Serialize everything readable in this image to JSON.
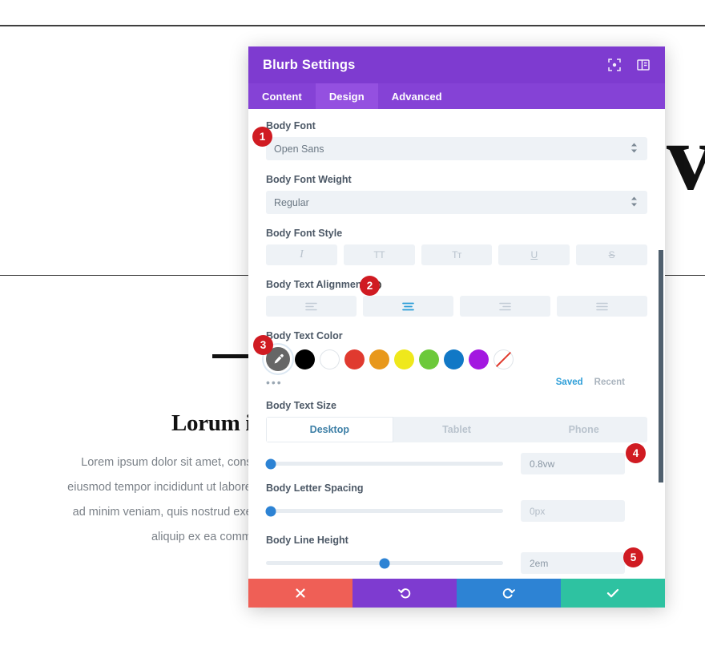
{
  "background": {
    "heading": "Lorum ip",
    "paragraph_lines": [
      "Lorem ipsum dolor sit amet, consec",
      "eiusmod tempor incididunt ut labore et",
      "ad minim veniam, quis nostrud exerci",
      "aliquip ex ea commod"
    ],
    "big_letters": "vi"
  },
  "modal": {
    "title": "Blurb Settings",
    "header_icons": [
      {
        "name": "focus-icon"
      },
      {
        "name": "layout-panel-icon"
      }
    ],
    "tabs": [
      {
        "label": "Content",
        "active": false
      },
      {
        "label": "Design",
        "active": true
      },
      {
        "label": "Advanced",
        "active": false
      }
    ],
    "fields": {
      "body_font": {
        "label": "Body Font",
        "value": "Open Sans"
      },
      "body_font_weight": {
        "label": "Body Font Weight",
        "value": "Regular"
      },
      "body_font_style": {
        "label": "Body Font Style",
        "buttons": [
          {
            "name": "italic-icon",
            "glyph": "I"
          },
          {
            "name": "uppercase-icon",
            "glyph": "TT"
          },
          {
            "name": "small-caps-icon",
            "glyph": "Tт"
          },
          {
            "name": "underline-icon",
            "glyph": "U"
          },
          {
            "name": "strikethrough-icon",
            "glyph": "S"
          }
        ]
      },
      "body_text_alignment": {
        "label": "Body Text Alignment",
        "has_reset": true,
        "options": [
          {
            "name": "align-left",
            "active": false
          },
          {
            "name": "align-center",
            "active": true
          },
          {
            "name": "align-right",
            "active": false
          },
          {
            "name": "align-justify",
            "active": false
          }
        ]
      },
      "body_text_color": {
        "label": "Body Text Color",
        "selected": "eyedropper",
        "swatches": [
          {
            "name": "swatch-eyedropper",
            "color": "#666666",
            "selected": true
          },
          {
            "name": "swatch-black",
            "color": "#000000"
          },
          {
            "name": "swatch-white",
            "color": "#ffffff"
          },
          {
            "name": "swatch-red",
            "color": "#e03a2f"
          },
          {
            "name": "swatch-orange",
            "color": "#e8981b"
          },
          {
            "name": "swatch-yellow",
            "color": "#efe81c"
          },
          {
            "name": "swatch-green",
            "color": "#6cc93a"
          },
          {
            "name": "swatch-blue",
            "color": "#1178c6"
          },
          {
            "name": "swatch-purple",
            "color": "#a318e0"
          },
          {
            "name": "swatch-transparent",
            "color": "none"
          }
        ],
        "more_label": "•••",
        "saved_label": "Saved",
        "recent_label": "Recent"
      },
      "body_text_size": {
        "label": "Body Text Size",
        "devices": [
          {
            "label": "Desktop",
            "active": true
          },
          {
            "label": "Tablet",
            "active": false
          },
          {
            "label": "Phone",
            "active": false
          }
        ],
        "value": "0.8vw",
        "slider_percent": 2
      },
      "body_letter_spacing": {
        "label": "Body Letter Spacing",
        "value": "0px",
        "slider_percent": 2
      },
      "body_line_height": {
        "label": "Body Line Height",
        "value": "2em",
        "slider_percent": 50
      }
    },
    "footer": [
      {
        "name": "cancel-button",
        "icon": "close-icon"
      },
      {
        "name": "undo-button",
        "icon": "undo-icon"
      },
      {
        "name": "redo-button",
        "icon": "redo-icon"
      },
      {
        "name": "save-button",
        "icon": "check-icon"
      }
    ]
  },
  "badges": [
    {
      "number": "1"
    },
    {
      "number": "2"
    },
    {
      "number": "3"
    },
    {
      "number": "4"
    },
    {
      "number": "5"
    }
  ],
  "colors": {
    "purple_header": "#7e3bd0",
    "purple_tabs": "#8542d6",
    "accent_blue": "#2d83d4",
    "badge_red": "#d01b22"
  }
}
